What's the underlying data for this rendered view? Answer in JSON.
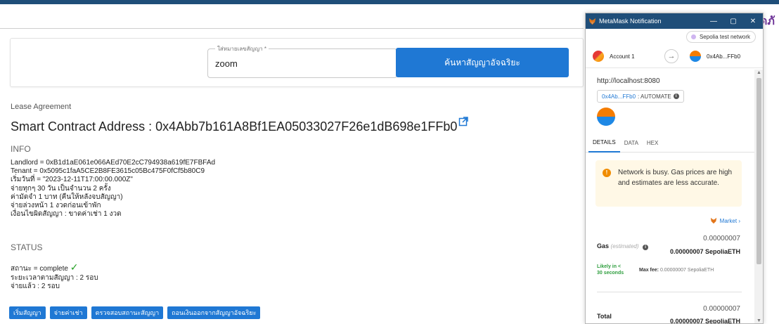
{
  "search": {
    "label": "ใส่หมายเลขสัญญา *",
    "value": "zoom",
    "button": "ค้นหาสัญญาอัจฉริยะ"
  },
  "lease": {
    "title": "Lease Agreement",
    "address": "Smart Contract Address : 0x4Abb7b161A8Bf1EA05033027F26e1dB698e1FFb0"
  },
  "info": {
    "heading": "INFO",
    "lines": [
      "Landlord = 0xB1d1aE061e066AEd70E2cC794938a619fE7FBFAd",
      "Tenant = 0x5095c1faA5CE2B8FE3615c05Bc475F0fCf5b80C9",
      "เริ่มวันที่ = \"2023-12-11T17:00:00.000Z\"",
      "จ่ายทุกๆ 30 วัน เป็นจำนวน 2 ครั้ง",
      "ค่ามัดจำ 1 บาท (คืนให้หลังจบสัญญา)",
      "จ่ายล่วงหน้า 1 งวดก่อนเข้าพัก",
      "เงื่อนไขผิดสัญญา : ขาดค่าเช่า 1 งวด"
    ]
  },
  "status": {
    "heading": "STATUS",
    "state": "สถานะ = complete",
    "duration": "ระยะเวลาตามสัญญา : 2 รอบ",
    "paid": "จ่ายแล้ว : 2 รอบ"
  },
  "actions": [
    "เริ่มสัญญา",
    "จ่ายค่าเช่า",
    "ตรวจสอบสถานะสัญญา",
    "ถอนเงินออกจากสัญญาอัจฉริยะ"
  ],
  "logo_fragment": "ดภั",
  "metamask": {
    "window_title": "MetaMask Notification",
    "network": "Sepolia test network",
    "from_account": "Account 1",
    "to_account": "0x4Ab...FFb0",
    "origin": "http://localhost:8080",
    "contract_tag_addr": "0x4Ab...FFb0",
    "contract_tag_label": ": AUTOMATE",
    "tabs": [
      "DETAILS",
      "DATA",
      "HEX"
    ],
    "warning": "Network is busy. Gas prices are high and estimates are less accurate.",
    "market": "Market",
    "gas_label": "Gas",
    "gas_estimated": "(estimated)",
    "gas_value": "0.00000007",
    "gas_value_bold": "0.00000007 SepoliaETH",
    "likely": "Likely in < 30 seconds",
    "maxfee_label": "Max fee:",
    "maxfee_value": "0.00000007 SepoliaETH",
    "total_label": "Total",
    "total_value": "0.00000007",
    "total_value_bold": "0.00000007 SepoliaETH"
  },
  "colors": {
    "primary_button": "#1f78d4",
    "titlebar": "#1f4e79",
    "warning_bg": "#fff8e6",
    "success": "#23a023"
  }
}
